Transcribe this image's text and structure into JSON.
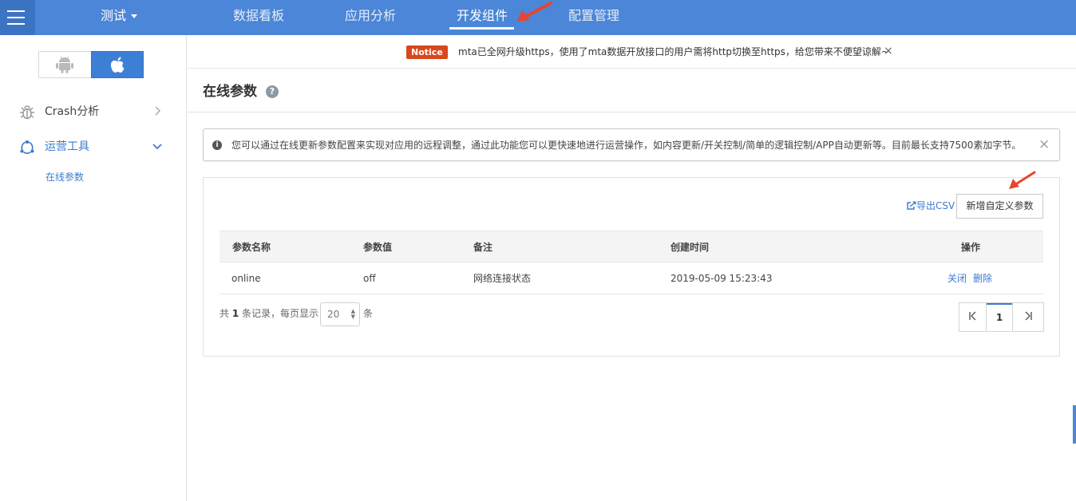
{
  "topbar": {
    "project_name": "测试",
    "nav": [
      "数据看板",
      "应用分析",
      "开发组件",
      "配置管理"
    ],
    "active_nav": "开发组件"
  },
  "sidebar": {
    "os_options": [
      "android",
      "ios"
    ],
    "os_selected": "ios",
    "items": [
      {
        "label": "Crash分析",
        "icon": "bug-icon",
        "expanded": false
      },
      {
        "label": "运营工具",
        "icon": "operation-tools-icon",
        "expanded": true
      }
    ],
    "subitem": "在线参数"
  },
  "notice": {
    "badge": "Notice",
    "text": "mta已全网升级https，使用了mta数据开放接口的用户需将http切换至https，给您带来不便望谅解~",
    "close": "×"
  },
  "page": {
    "title": "在线参数",
    "help": "?"
  },
  "alert": {
    "icon": "i",
    "text": "您可以通过在线更新参数配置来实现对应用的远程调整，通过此功能您可以更快速地进行运营操作，如内容更新/开关控制/简单的逻辑控制/APP自动更新等。目前最长支持7500素加字节。",
    "close": "×"
  },
  "toolbar": {
    "export_label": "导出CSV",
    "add_label": "新增自定义参数"
  },
  "table": {
    "headers": [
      "参数名称",
      "参数值",
      "备注",
      "创建时间",
      "操作"
    ],
    "rows": [
      {
        "name": "online",
        "value": "off",
        "note": "网络连接状态",
        "created": "2019-05-09 15:23:43",
        "actions": [
          "关闭",
          "删除"
        ]
      }
    ]
  },
  "footer": {
    "prefix": "共",
    "count": "1",
    "middle": "条记录，每页显示",
    "page_size": "20",
    "suffix": "条"
  },
  "pager": {
    "current": "1"
  },
  "colors": {
    "topbar": "#4b86d8",
    "accent": "#3d7bd0",
    "notice_badge": "#d9471c",
    "annotation_arrow": "#e8452c"
  }
}
